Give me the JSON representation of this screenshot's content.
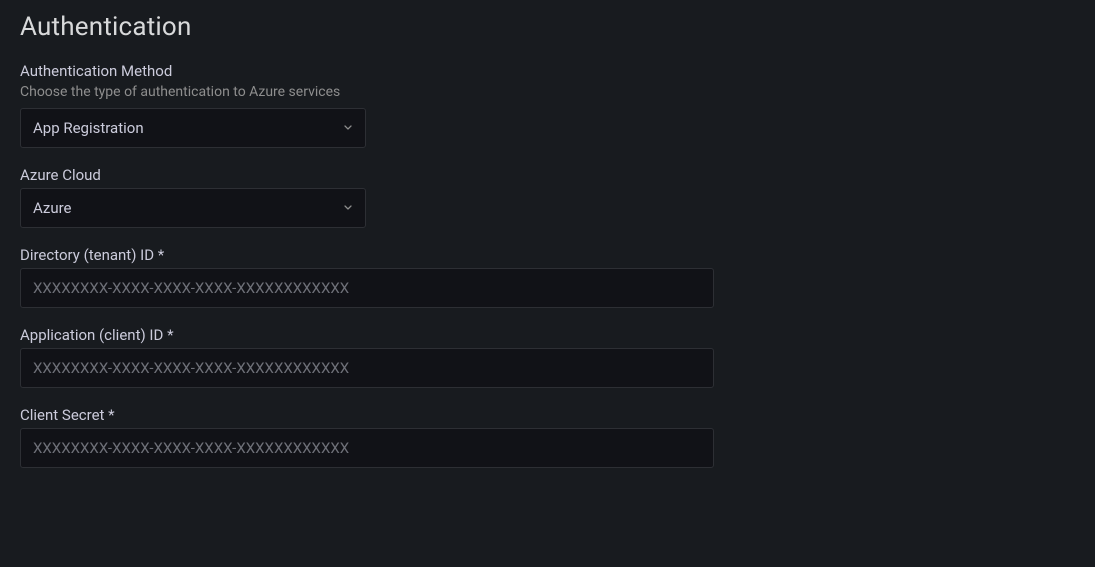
{
  "section": {
    "title": "Authentication"
  },
  "auth_method": {
    "label": "Authentication Method",
    "description": "Choose the type of authentication to Azure services",
    "value": "App Registration"
  },
  "azure_cloud": {
    "label": "Azure Cloud",
    "value": "Azure"
  },
  "tenant_id": {
    "label": "Directory (tenant) ID *",
    "placeholder": "XXXXXXXX-XXXX-XXXX-XXXX-XXXXXXXXXXXX",
    "value": ""
  },
  "client_id": {
    "label": "Application (client) ID *",
    "placeholder": "XXXXXXXX-XXXX-XXXX-XXXX-XXXXXXXXXXXX",
    "value": ""
  },
  "client_secret": {
    "label": "Client Secret *",
    "placeholder": "XXXXXXXX-XXXX-XXXX-XXXX-XXXXXXXXXXXX",
    "value": ""
  }
}
